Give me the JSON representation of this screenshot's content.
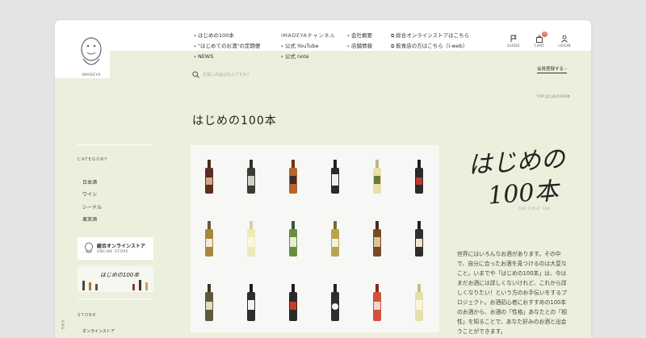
{
  "brand": {
    "logo_text": "IMADEYA"
  },
  "nav": {
    "col1": [
      "はじめの100本",
      "\"はじめてのお酒\"の定期便",
      "NEWS"
    ],
    "col2_head": "IMADEYAチャンネル",
    "col2": [
      "公式 YouTube",
      "公式 note"
    ],
    "col3": [
      "会社概要",
      "店舗情報"
    ],
    "col4": [
      "総合オンラインストアはこちら",
      "飲食店の方はこちら（i-web）"
    ]
  },
  "utility": {
    "guide": "GUIDE",
    "cart": "CART",
    "cart_count": "0",
    "login": "LOGIN"
  },
  "search": {
    "placeholder": "お探し商品はなんですか？"
  },
  "signup": {
    "label": "会員登録する ›"
  },
  "breadcrumb": {
    "text": "TOP   はじめの100本"
  },
  "page": {
    "title": "はじめの100本"
  },
  "sidebar": {
    "category_head": "CATEGORY",
    "categories": [
      "日本酒",
      "ワイン",
      "シードル",
      "果実酒"
    ],
    "banner1_title": "総合オンラインストア",
    "banner1_sub": "ONLINE STORE",
    "banner2_text": "はじめの100本",
    "store_head": "STORE",
    "store_item": "オンラインストア",
    "vertical_text": "SNS"
  },
  "hero": {
    "handwritten_line1": "はじめの",
    "handwritten_line2": "100本",
    "subtitle": "THE FIRST 100"
  },
  "description": "世界にはいろんなお酒があります。その中で、自分に合ったお酒を見つけるのは大変なこと。いまでや「はじめの100本」は、今はまだお酒には詳しくないけれど、これから詳しくなりたい！という方のお手伝いをするプロジェクト。お酒初心者におすすめの100本のお酒から、お酒の「性格」あなたとの「相性」を知ることで、あなた好みのお酒と出会うことができます。",
  "colors": {
    "frame_bg": "#ecefdb",
    "header_bg": "#ffffff",
    "accent": "#e0704e"
  }
}
